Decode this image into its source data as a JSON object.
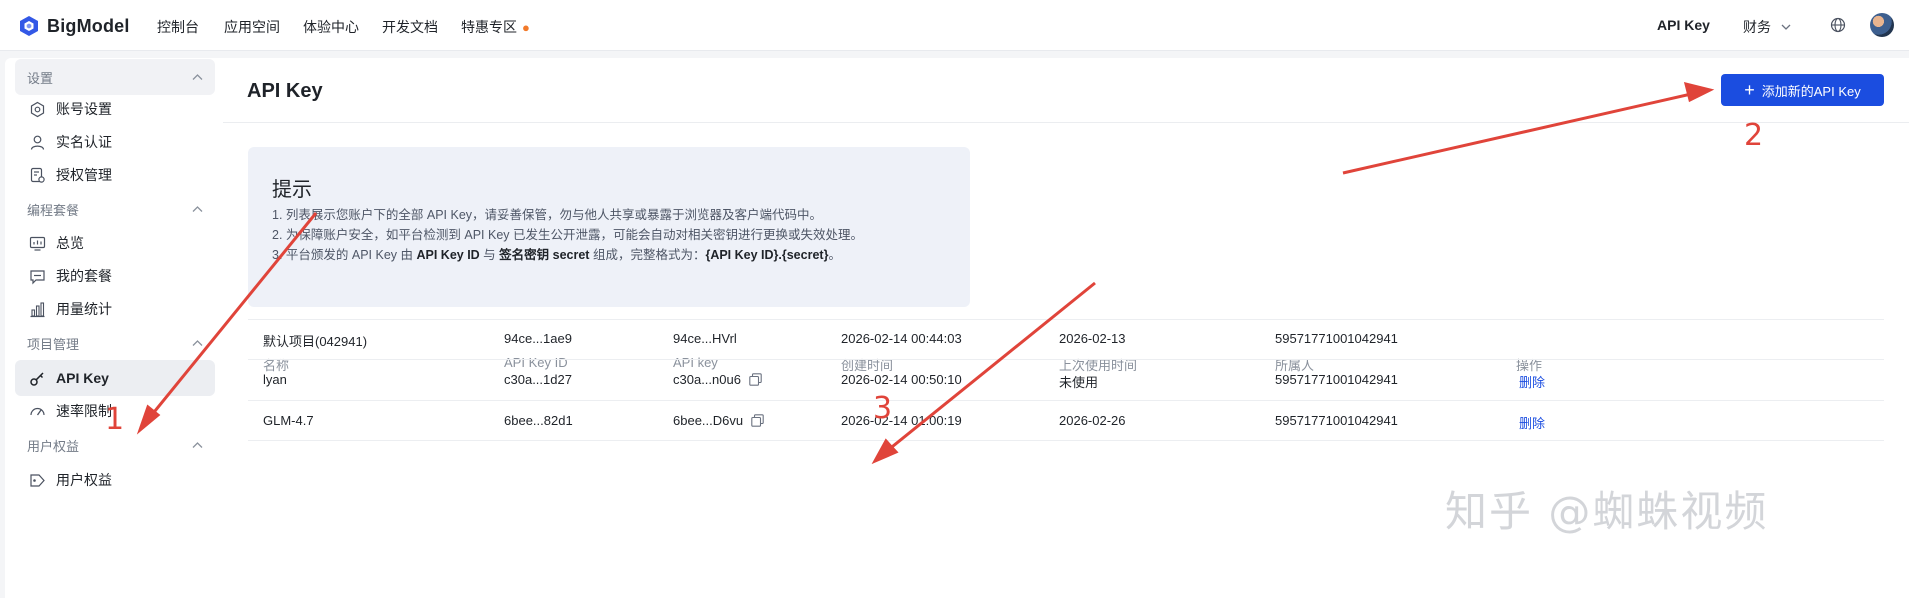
{
  "brand": {
    "name": "BigModel",
    "color": "#3358e6"
  },
  "topnav": {
    "items": [
      "控制台",
      "应用空间",
      "体验中心",
      "开发文档",
      "特惠专区"
    ],
    "right_apikey": "API Key",
    "right_finance": "财务"
  },
  "sidebar": {
    "group_settings": "设置",
    "settings_items": [
      "账号设置",
      "实名认证",
      "授权管理"
    ],
    "group_coding": "编程套餐",
    "coding_items": [
      "总览",
      "我的套餐",
      "用量统计"
    ],
    "group_project": "项目管理",
    "project_items": [
      "API Key",
      "速率限制"
    ],
    "group_benefits": "用户权益",
    "benefits_items": [
      "用户权益"
    ]
  },
  "main": {
    "title": "API Key",
    "add_button": "添加新的API Key",
    "tip": {
      "title": "提示",
      "line1": "1. 列表展示您账户下的全部 API Key，请妥善保管，勿与他人共享或暴露于浏览器及客户端代码中。",
      "line2": "2. 为保障账户安全，如平台检测到 API Key 已发生公开泄露，可能会自动对相关密钥进行更换或失效处理。",
      "line3_a": "3. 平台颁发的 API Key 由 ",
      "line3_b": "API Key ID",
      "line3_c": " 与 ",
      "line3_d": "签名密钥 secret",
      "line3_e": " 组成，完整格式为：",
      "line3_f": "{API Key ID}.{secret}",
      "line3_g": "。"
    },
    "table": {
      "headers": [
        "名称",
        "API Key ID",
        "API key",
        "创建时间",
        "上次使用时间",
        "所属人",
        "操作"
      ],
      "rows": [
        {
          "name": "默认项目(042941)",
          "id": "94ce...1ae9",
          "key": "94ce...HVrl",
          "created": "2026-02-14 00:44:03",
          "last_used": "2026-02-13",
          "owner": "59571771001042941",
          "action": ""
        },
        {
          "name": "lyan",
          "id": "c30a...1d27",
          "key": "c30a...n0u6",
          "created": "2026-02-14 00:50:10",
          "last_used": "未使用",
          "owner": "59571771001042941",
          "action": "删除"
        },
        {
          "name": "GLM-4.7",
          "id": "6bee...82d1",
          "key": "6bee...D6vu",
          "created": "2026-02-14 01:00:19",
          "last_used": "2026-02-26",
          "owner": "59571771001042941",
          "action": "删除"
        }
      ]
    }
  },
  "annotations": {
    "n1": "1",
    "n2": "2",
    "n3": "3",
    "color": "#e0443a"
  },
  "watermark": "知乎 @蜘蛛视频"
}
